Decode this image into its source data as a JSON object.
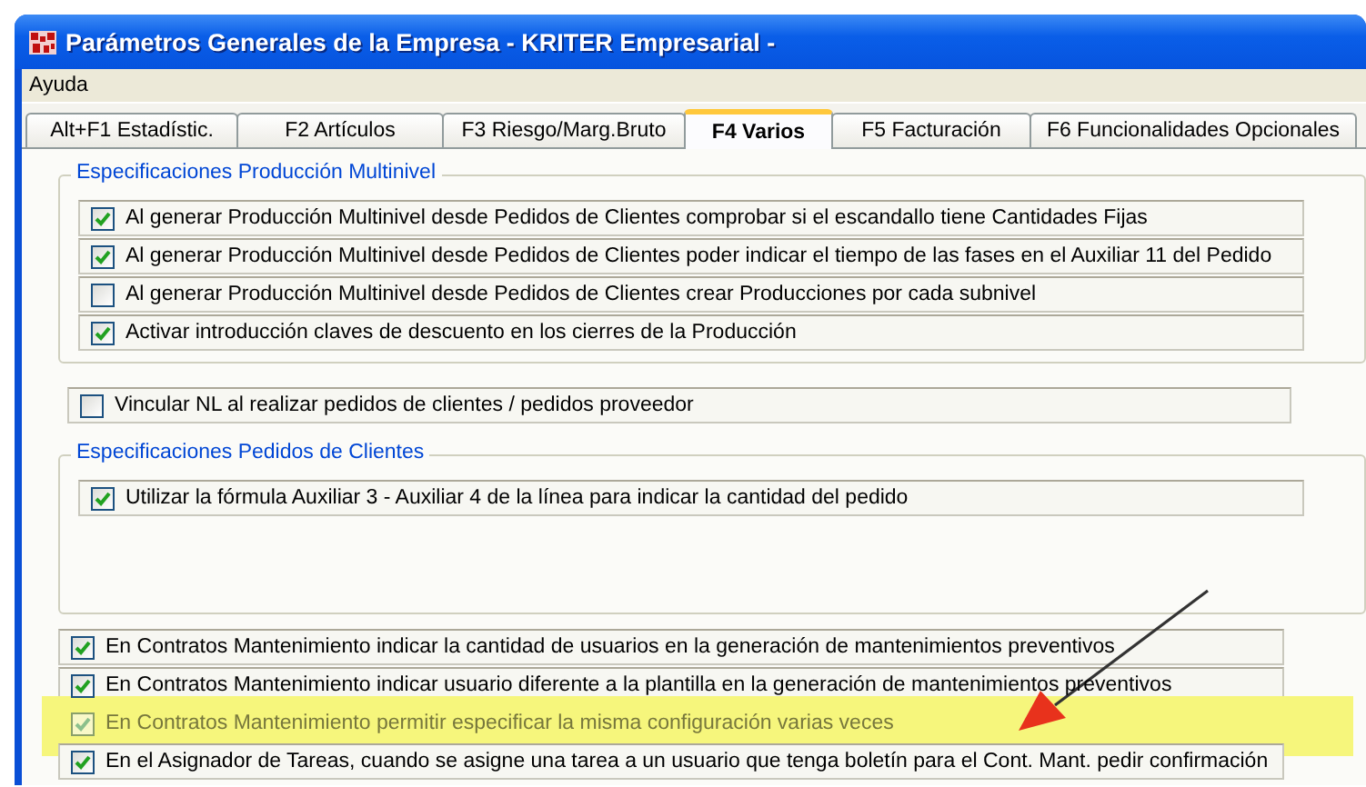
{
  "window": {
    "title": "Parámetros Generales de la Empresa - KRITER Empresarial -"
  },
  "menu": [
    {
      "label": "Ayuda"
    }
  ],
  "tabs": [
    {
      "label": "Alt+F1 Estadístic.",
      "selected": false
    },
    {
      "label": "F2 Artículos",
      "selected": false
    },
    {
      "label": "F3 Riesgo/Marg.Bruto",
      "selected": false
    },
    {
      "label": "F4 Varios",
      "selected": true
    },
    {
      "label": "F5 Facturación",
      "selected": false
    },
    {
      "label": "F6 Funcionalidades Opcionales",
      "selected": false
    }
  ],
  "sections": [
    {
      "kind": "group",
      "legend": "Especificaciones Producción Multinivel",
      "rows": [
        {
          "label": "Al generar Producción Multinivel desde Pedidos de Clientes comprobar si el escandallo tiene Cantidades Fijas",
          "checked": true
        },
        {
          "label": "Al generar Producción Multinivel desde Pedidos de Clientes poder indicar el tiempo de las fases en el Auxiliar 11 del Pedido",
          "checked": true
        },
        {
          "label": "Al generar Producción Multinivel desde Pedidos de Clientes crear Producciones por cada subnivel",
          "checked": false
        },
        {
          "label": "Activar introducción claves de descuento en los cierres de la Producción",
          "checked": true
        }
      ]
    },
    {
      "kind": "plain",
      "rows": [
        {
          "label": "Vincular NL al realizar  pedidos de clientes /  pedidos proveedor",
          "checked": false
        }
      ]
    },
    {
      "kind": "group",
      "legend": "Especificaciones Pedidos de Clientes",
      "rows": [
        {
          "label": "Utilizar la fórmula Auxiliar 3 - Auxiliar 4 de la línea para indicar la cantidad del pedido",
          "checked": true
        }
      ]
    },
    {
      "kind": "plain",
      "rows": [
        {
          "label": "En Contratos Mantenimiento indicar la cantidad de usuarios en la generación de mantenimientos preventivos",
          "checked": true,
          "highlighted": false
        },
        {
          "label": "En Contratos Mantenimiento indicar usuario diferente a la plantilla en la generación de mantenimientos preventivos",
          "checked": true,
          "highlighted": false
        },
        {
          "label": "En Contratos Mantenimiento permitir especificar la misma configuración varias veces",
          "checked": true,
          "highlighted": true
        },
        {
          "label": "En el Asignador de Tareas, cuando se asigne una tarea a un usuario que tenga boletín para el Cont. Mant. pedir confirmación",
          "checked": true,
          "highlighted": false
        }
      ]
    }
  ]
}
